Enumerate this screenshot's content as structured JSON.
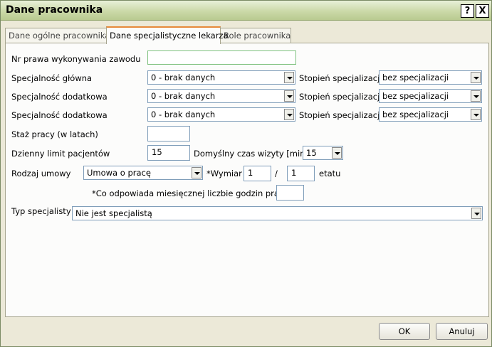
{
  "window": {
    "title": "Dane pracownika",
    "help_label": "?",
    "close_label": "X"
  },
  "tabs": [
    {
      "label": "Dane ogólne pracownika"
    },
    {
      "label": "Dane specjalistyczne lekarza"
    },
    {
      "label": "Role pracownika"
    }
  ],
  "form": {
    "license_label": "Nr prawa wykonywania zawodu",
    "license_value": "",
    "spec_rows": [
      {
        "label": "Specjalność główna",
        "value": "0 - brak danych",
        "degree_label": "Stopień specjalizacji",
        "degree_value": "bez specjalizacji"
      },
      {
        "label": "Specjalność dodatkowa",
        "value": "0 - brak danych",
        "degree_label": "Stopień specjalizacji",
        "degree_value": "bez specjalizacji"
      },
      {
        "label": "Specjalność dodatkowa",
        "value": "0 - brak danych",
        "degree_label": "Stopień specjalizacji",
        "degree_value": "bez specjalizacji"
      }
    ],
    "seniority_label": "Staż pracy (w latach)",
    "seniority_value": "",
    "daily_limit_label": "Dzienny limit pacjentów",
    "daily_limit_value": "15",
    "visit_time_label": "Domyślny czas wizyty [min]",
    "visit_time_value": "15",
    "contract_label": "Rodzaj umowy",
    "contract_value": "Umowa o pracę",
    "fte_label": "*Wymiar",
    "fte_numerator": "1",
    "fte_slash": "/",
    "fte_denominator": "1",
    "fte_suffix": "etatu",
    "hours_note": "*Co odpowiada miesięcznej liczbie godzin pracy",
    "hours_value": "",
    "specialist_type_label": "Typ specjalisty",
    "specialist_type_value": "Nie jest specjalistą"
  },
  "buttons": {
    "ok": "OK",
    "cancel": "Anuluj"
  }
}
